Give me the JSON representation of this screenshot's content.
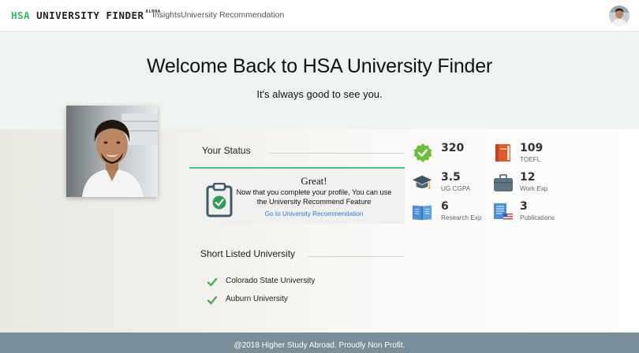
{
  "nav": {
    "brand_hsa": "HSA",
    "brand_name": "UNIVERSITY FINDER",
    "brand_badge": "ALPHA",
    "links": [
      "Insights",
      "University Recommendation"
    ]
  },
  "hero": {
    "title": "Welcome Back to HSA University Finder",
    "subtitle": "It's always good to see you."
  },
  "status": {
    "title": "Your Status",
    "card_heading": "Great!",
    "card_message": "Now that you complete your profile, You can use the University Recommend Feature",
    "card_link": "Go to University Recommendation"
  },
  "stats": [
    {
      "value": "320",
      "label": "",
      "icon": "verified-badge-icon"
    },
    {
      "value": "109",
      "label": "TOEFL",
      "icon": "book-icon"
    },
    {
      "value": "3.5",
      "label": "UG CGPA",
      "icon": "graduation-cap-icon"
    },
    {
      "value": "12",
      "label": "Work Exp",
      "icon": "briefcase-icon"
    },
    {
      "value": "6",
      "label": "Research Exp",
      "icon": "open-book-icon"
    },
    {
      "value": "3",
      "label": "Publications",
      "icon": "newspaper-icon"
    }
  ],
  "shortlist": {
    "title": "Short Listed University",
    "items": [
      "Colorado State University",
      "Auburn University"
    ]
  },
  "footer": {
    "text": "@2018 Higher Study Abroad. Proudly Non Profit."
  },
  "colors": {
    "brand_green": "#2bbf5a",
    "accent_green": "#46c18a",
    "link_blue": "#2a7be4",
    "footer_bg": "#7a8e99"
  }
}
